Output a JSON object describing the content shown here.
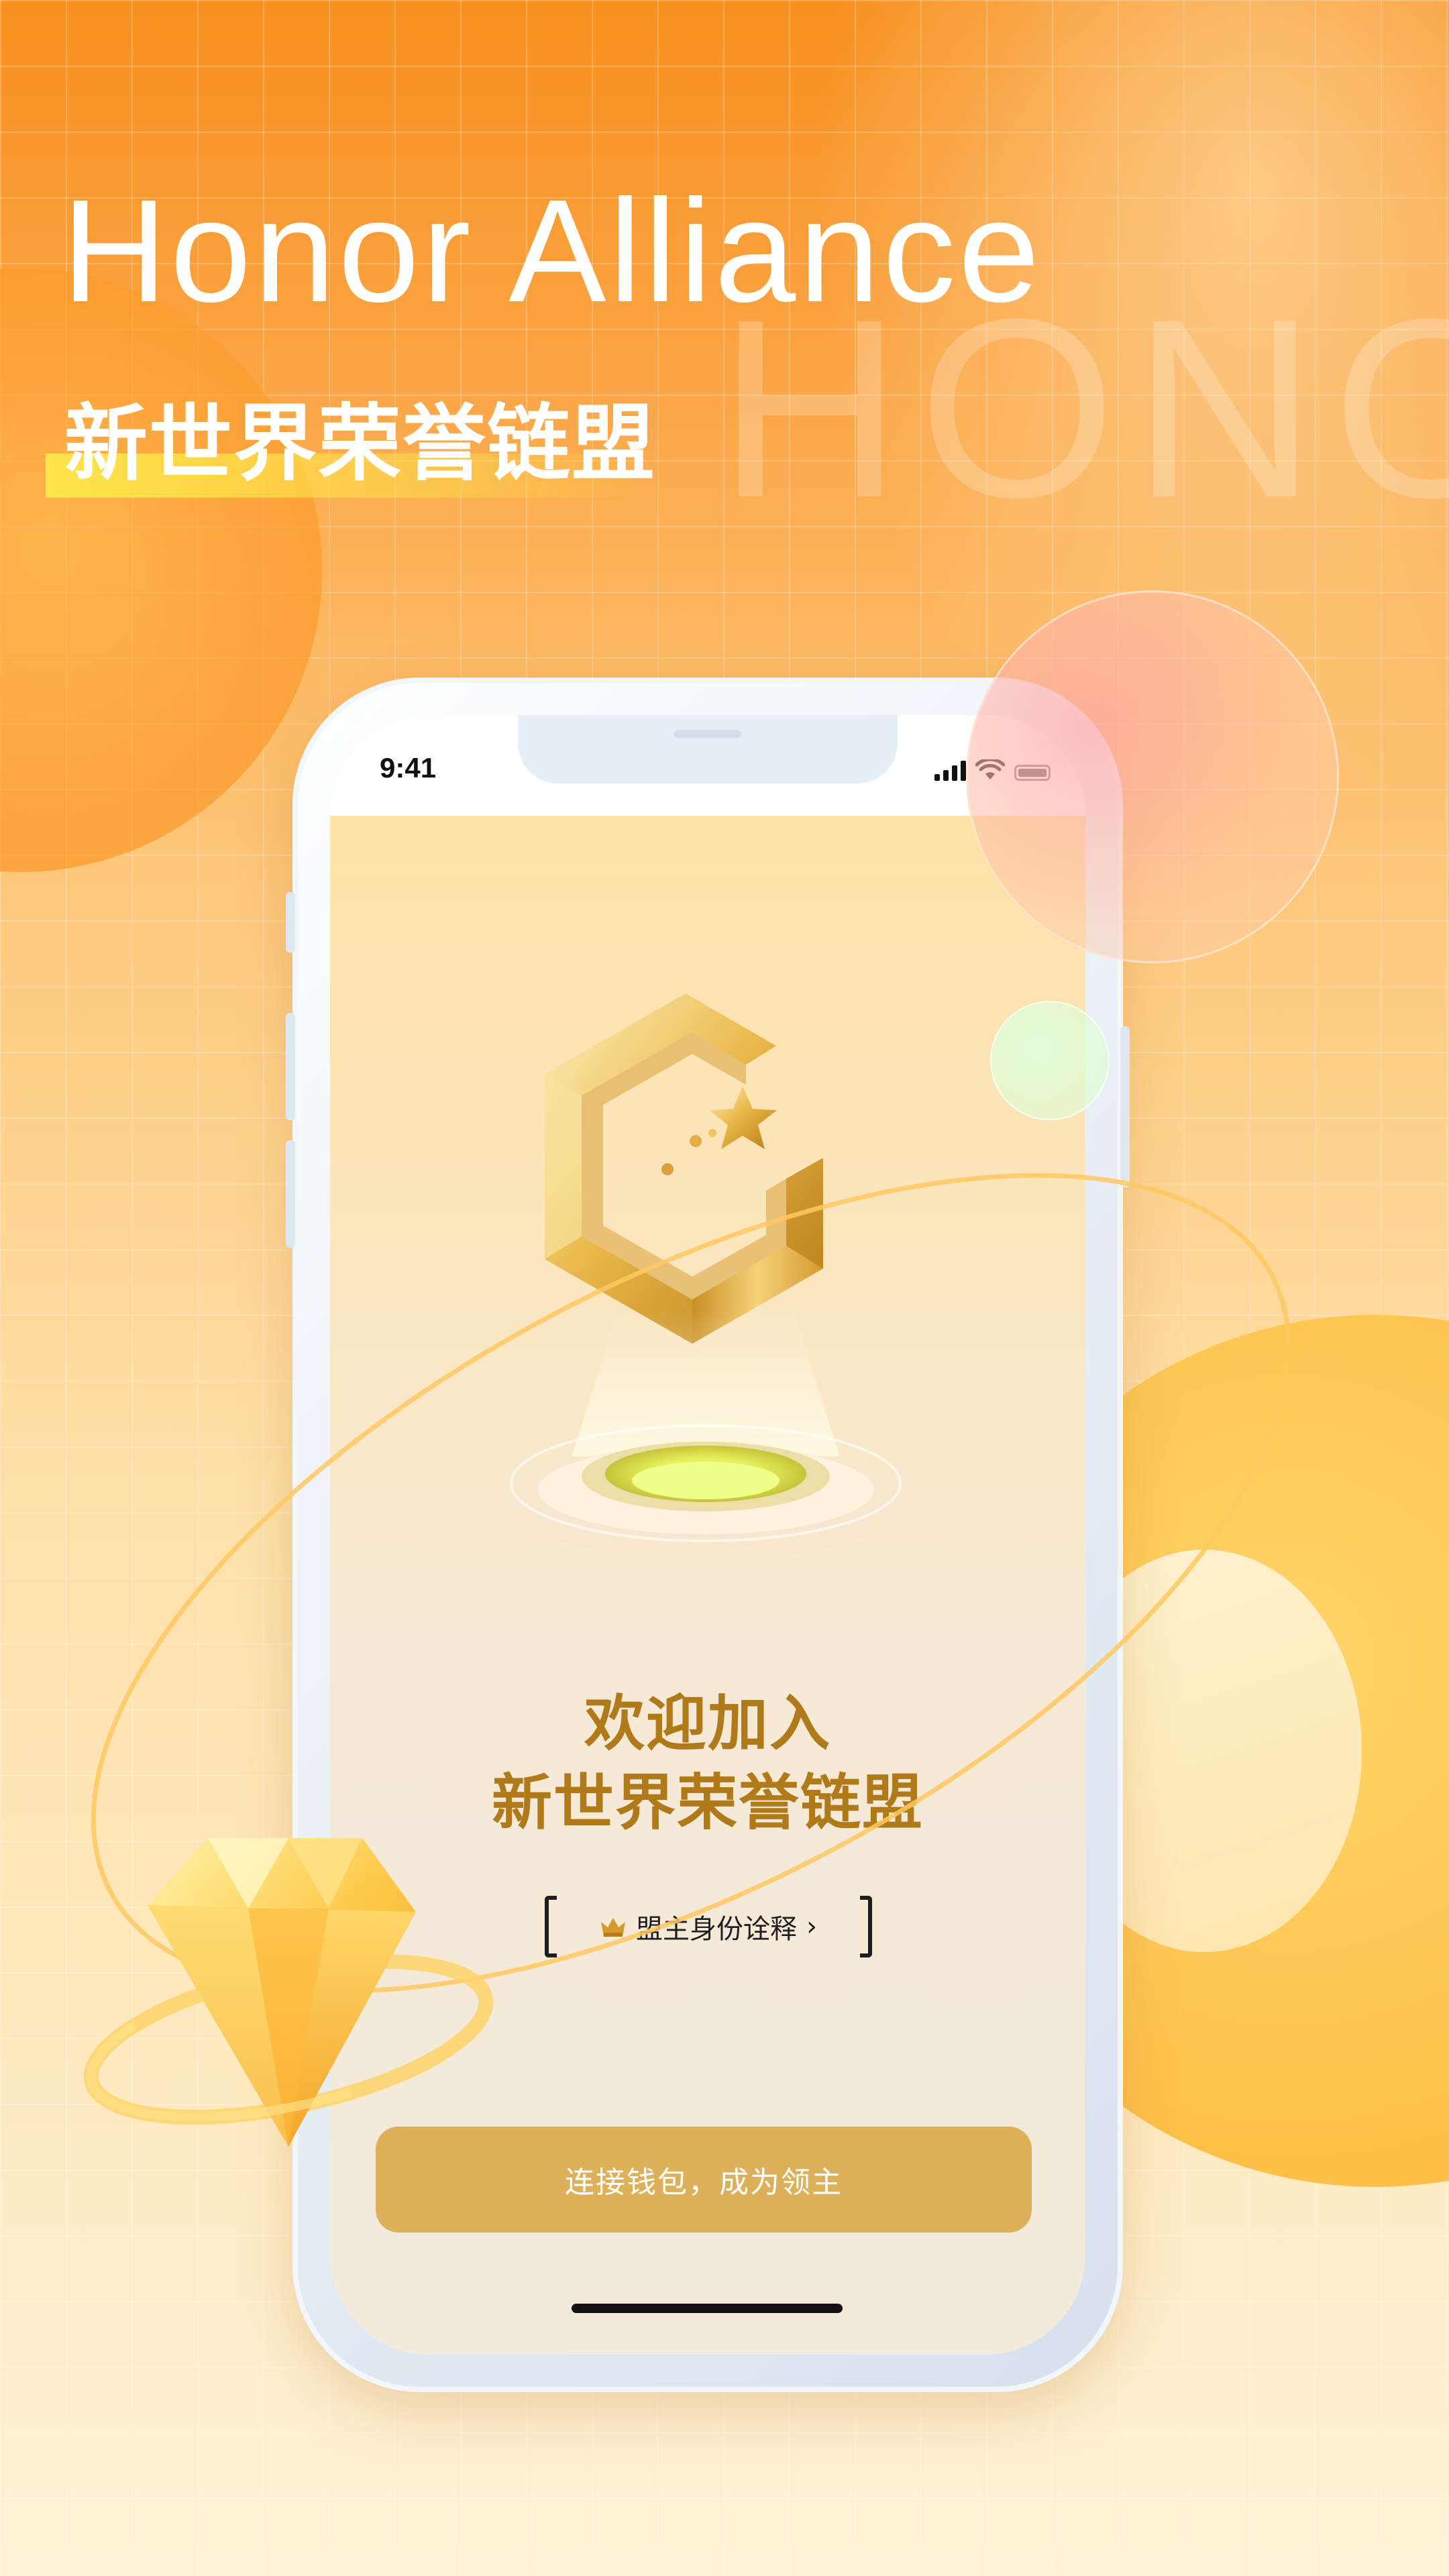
{
  "poster": {
    "headline": "Honor Alliance",
    "subheadline": "新世界荣誉链盟",
    "watermark": "HONO"
  },
  "phone": {
    "status_bar": {
      "time": "9:41"
    },
    "app": {
      "welcome_line1": "欢迎加入",
      "welcome_line2": "新世界荣誉链盟",
      "identity_link": {
        "label": "盟主身份诠释",
        "chevron": "›",
        "icon": "crown-icon"
      },
      "cta_button": {
        "label": "连接钱包，成为领主"
      }
    }
  },
  "colors": {
    "accent_gold": "#b07a1a",
    "button_gold": "#dcb15a",
    "orange": "#f7901f"
  }
}
